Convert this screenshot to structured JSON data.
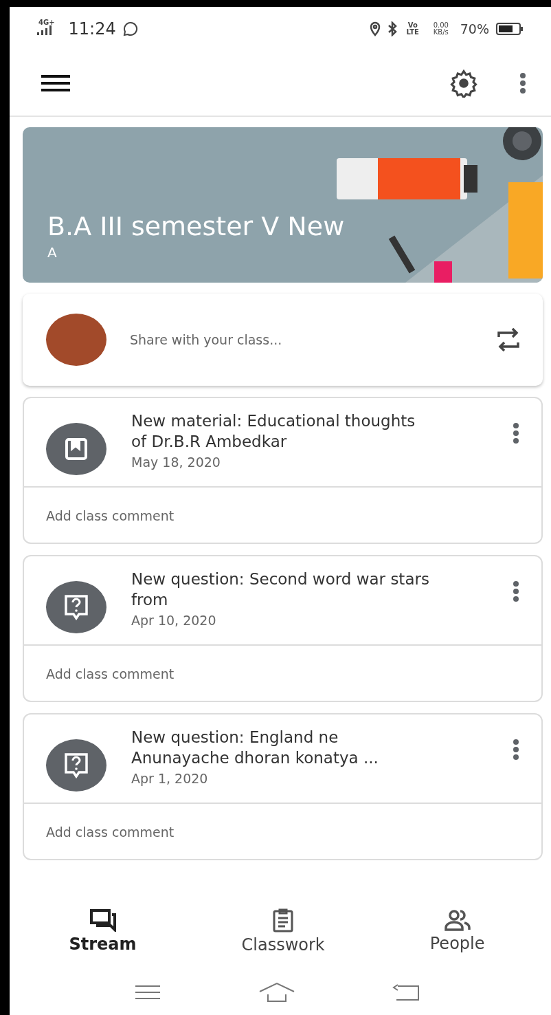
{
  "status_bar": {
    "network": "4G+",
    "time": "11:24",
    "volte": "Vo LTE",
    "speed": "0.00 KB/s",
    "battery": "70%"
  },
  "class_banner": {
    "title": "B.A III semester V New",
    "section": "A"
  },
  "share": {
    "placeholder": "Share with your class..."
  },
  "posts": [
    {
      "kind": "material",
      "title": "New material: Educational thoughts of Dr.B.R Ambedkar",
      "date": "May 18, 2020",
      "comment": "Add class comment"
    },
    {
      "kind": "question",
      "title": "New question: Second word war stars from",
      "date": "Apr 10, 2020",
      "comment": "Add class comment"
    },
    {
      "kind": "question",
      "title": "New question: England ne Anunayache dhoran konatya ...",
      "date": "Apr 1, 2020",
      "comment": "Add class comment"
    }
  ],
  "bottom_nav": [
    {
      "kind": "stream",
      "label": "Stream",
      "selected": true
    },
    {
      "kind": "classwork",
      "label": "Classwork",
      "selected": false
    },
    {
      "kind": "people",
      "label": "People",
      "selected": false
    }
  ]
}
